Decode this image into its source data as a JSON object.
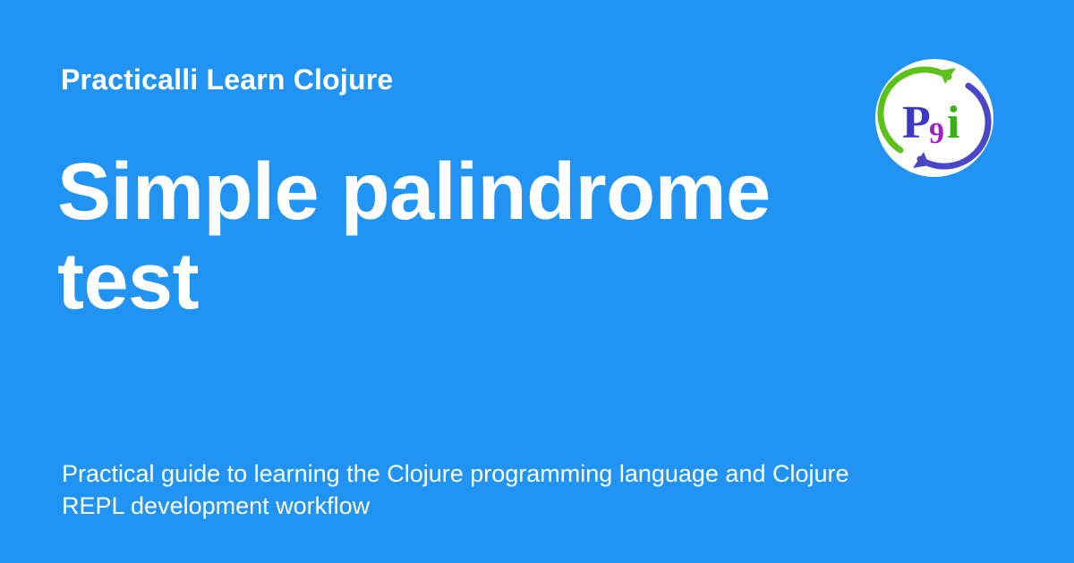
{
  "site": {
    "name": "Practicalli Learn Clojure"
  },
  "page": {
    "title": "Simple palindrome test",
    "description": "Practical guide to learning the Clojure programming language and Clojure REPL development workflow"
  },
  "logo": {
    "icon": "practicalli-logo",
    "letters": [
      "P",
      "9",
      "i"
    ],
    "colors": {
      "background": "#2194f3",
      "circle": "#ffffff",
      "arrow_green": "#5cc21a",
      "arrow_blue": "#4a46c8",
      "letter_p": "#3a3ac4",
      "letter_9": "#a21ec6",
      "letter_i": "#3bb01a"
    }
  }
}
